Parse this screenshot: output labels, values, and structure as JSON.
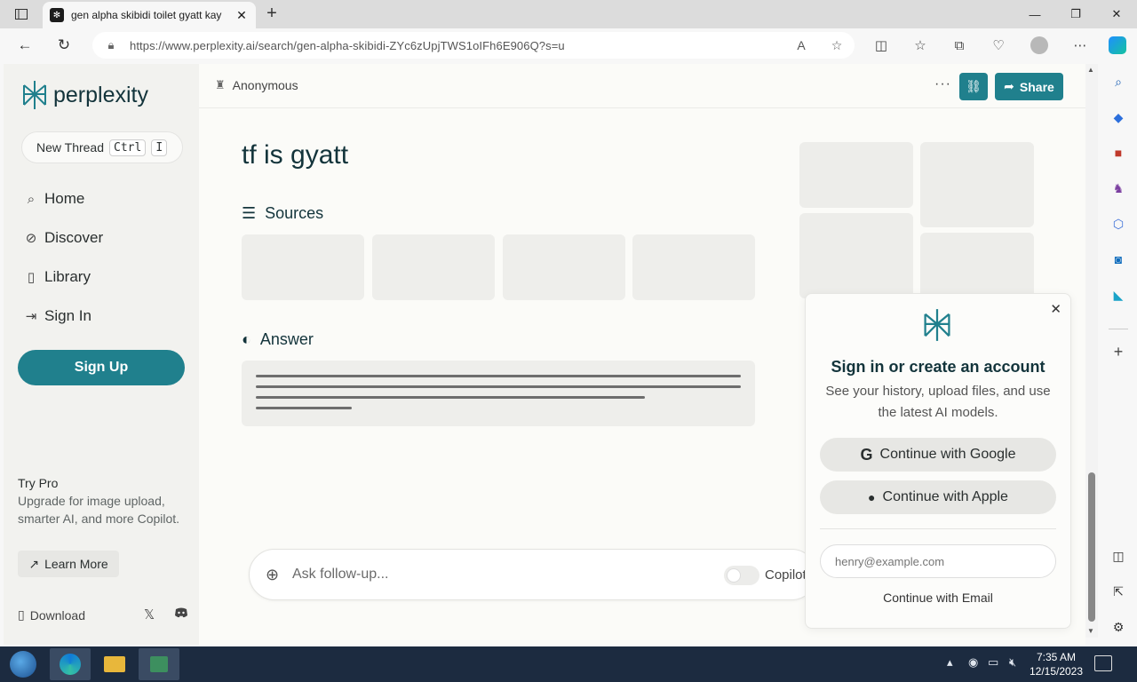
{
  "browser": {
    "tab_title": "gen alpha skibidi toilet gyatt kay",
    "url": "https://www.perplexity.ai/search/gen-alpha-skibidi-ZYc6zUpjTWS1oIFh6E906Q?s=u"
  },
  "sidebar": {
    "logo_text": "perplexity",
    "new_thread": "New Thread",
    "kbd_ctrl": "Ctrl",
    "kbd_i": "I",
    "items": [
      {
        "label": "Home",
        "icon": "search-icon"
      },
      {
        "label": "Discover",
        "icon": "compass-icon"
      },
      {
        "label": "Library",
        "icon": "library-icon"
      },
      {
        "label": "Sign In",
        "icon": "sign-in-icon"
      }
    ],
    "signup": "Sign Up",
    "try_pro_title": "Try Pro",
    "try_pro_text": "Upgrade for image upload, smarter AI, and more Copilot.",
    "learn_more": "Learn More",
    "download": "Download"
  },
  "main": {
    "user": "Anonymous",
    "share": "Share",
    "query": "tf is gyatt",
    "sources_label": "Sources",
    "answer_label": "Answer",
    "followup_placeholder": "Ask follow-up...",
    "copilot_label": "Copilot"
  },
  "popup": {
    "title": "Sign in or create an account",
    "subtitle": "See your history, upload files, and use the latest AI models.",
    "google": "Continue with Google",
    "apple": "Continue with Apple",
    "email_placeholder": "henry@example.com",
    "email_continue": "Continue with Email"
  },
  "taskbar": {
    "time": "7:35 AM",
    "date": "12/15/2023"
  },
  "colors": {
    "accent": "#20808d",
    "brand_text": "#13343b"
  }
}
